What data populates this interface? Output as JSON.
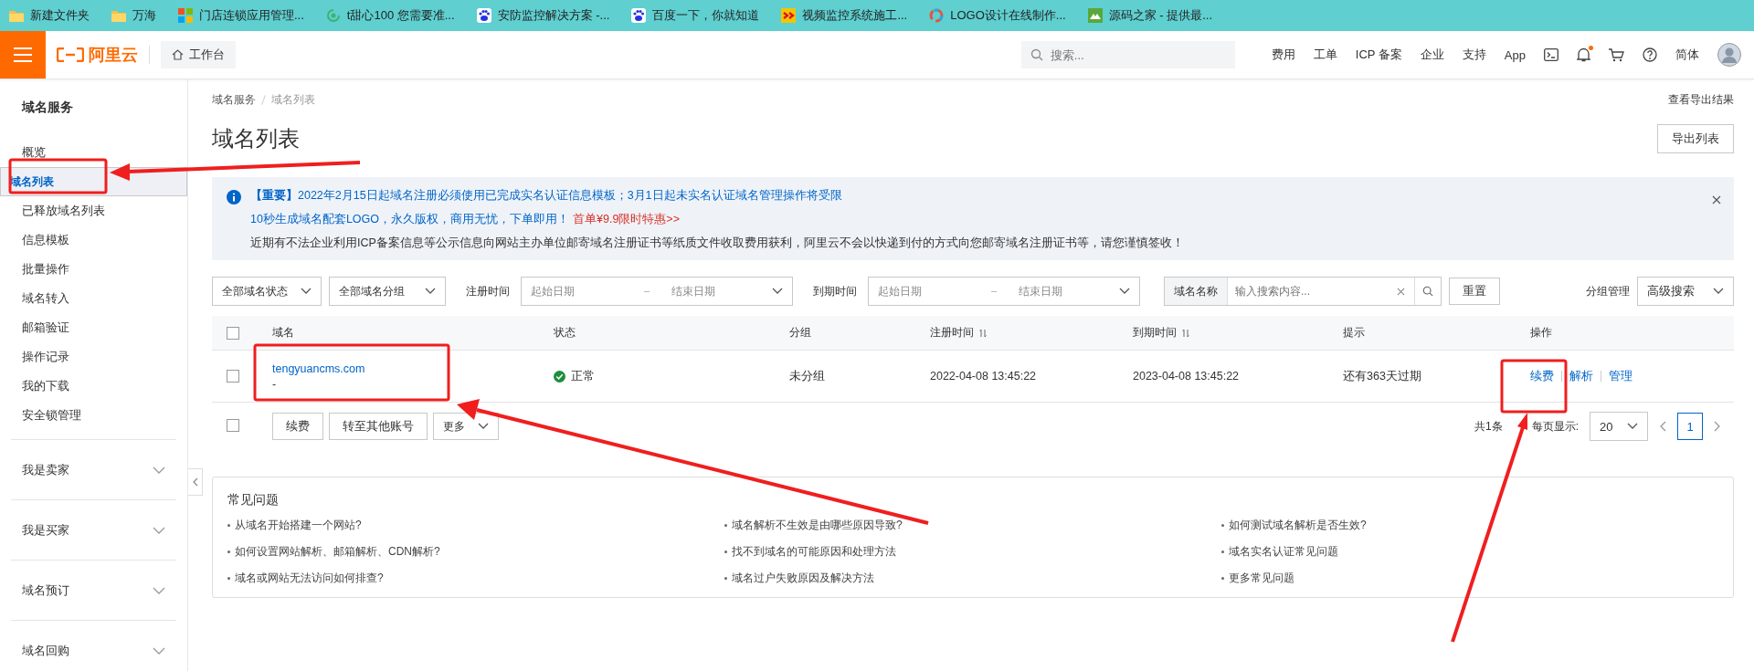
{
  "bookmarks": [
    {
      "label": "新建文件夹",
      "kind": "folder"
    },
    {
      "label": "万海",
      "kind": "folder"
    },
    {
      "label": "门店连锁应用管理...",
      "kind": "grid"
    },
    {
      "label": "t甜心100 您需要准...",
      "kind": "swirl"
    },
    {
      "label": "安防监控解决方案 -...",
      "kind": "paw"
    },
    {
      "label": "百度一下，你就知道",
      "kind": "paw"
    },
    {
      "label": "视频监控系统施工...",
      "kind": "sbadge"
    },
    {
      "label": "LOGO设计在线制作...",
      "kind": "ring"
    },
    {
      "label": "源码之家 - 提供最...",
      "kind": "mbadge"
    }
  ],
  "topbar": {
    "logo": "阿里云",
    "workbench": "工作台",
    "search_placeholder": "搜索...",
    "links": [
      "费用",
      "工单",
      "ICP 备案",
      "企业",
      "支持",
      "App"
    ],
    "notification_dot": true,
    "language": "简体"
  },
  "sidebar": {
    "title": "域名服务",
    "items": [
      {
        "label": "概览",
        "selected": false
      },
      {
        "label": "域名列表",
        "selected": true
      },
      {
        "label": "已释放域名列表",
        "selected": false
      },
      {
        "label": "信息模板",
        "selected": false
      },
      {
        "label": "批量操作",
        "selected": false
      },
      {
        "label": "域名转入",
        "selected": false
      },
      {
        "label": "邮箱验证",
        "selected": false
      },
      {
        "label": "操作记录",
        "selected": false
      },
      {
        "label": "我的下载",
        "selected": false
      },
      {
        "label": "安全锁管理",
        "selected": false
      }
    ],
    "sections": [
      {
        "label": "我是卖家",
        "expanded": false
      },
      {
        "label": "我是买家",
        "expanded": false
      },
      {
        "label": "域名预订",
        "expanded": false
      },
      {
        "label": "域名回购",
        "expanded": false
      }
    ]
  },
  "breadcrumb": [
    "域名服务",
    "域名列表"
  ],
  "page": {
    "title": "域名列表",
    "export_results": "查看导出结果",
    "export_button": "导出列表"
  },
  "notice": {
    "line1": "**【重要】**2022年2月15日起域名注册必须使用已完成实名认证信息模板；3月1日起未实名认证域名管理操作将受限",
    "line2": "10秒生成域名配套LOGO，永久版权，商用无忧，下单即用！",
    "line2_offer": "首单¥9.9限时特惠>>",
    "line3": "近期有不法企业利用ICP备案信息等公示信息向网站主办单位邮寄域名注册证书等纸质文件收取费用获利，阿里云不会以快递到付的方式向您邮寄域名注册证书等，请您谨慎签收！"
  },
  "filters": {
    "status": "全部域名状态",
    "group": "全部域名分组",
    "reg_label": "注册时间",
    "reg_start": "起始日期",
    "reg_end": "结束日期",
    "exp_label": "到期时间",
    "exp_start": "起始日期",
    "exp_end": "结束日期",
    "search_scope": "域名名称",
    "search_placeholder": "输入搜索内容...",
    "reset": "重置",
    "group_manage": "分组管理",
    "advanced": "高级搜索"
  },
  "table": {
    "header_checked": false,
    "columns": [
      {
        "label": "域名",
        "sortable": false
      },
      {
        "label": "状态",
        "sortable": false
      },
      {
        "label": "分组",
        "sortable": false
      },
      {
        "label": "注册时间",
        "sortable": true
      },
      {
        "label": "到期时间",
        "sortable": true
      },
      {
        "label": "提示",
        "sortable": false
      },
      {
        "label": "操作",
        "sortable": false
      }
    ],
    "rows": [
      {
        "checked": false,
        "domain": "tengyuancms.com",
        "remark": "-",
        "status": "正常",
        "group": "未分组",
        "registered": "2022-04-08 13:45:22",
        "expires": "2023-04-08 13:45:22",
        "hint": "还有363天过期",
        "actions": [
          "续费",
          "解析",
          "管理"
        ]
      }
    ]
  },
  "bulk": {
    "checked": false,
    "buttons": [
      "续费",
      "转至其他账号"
    ],
    "more": "更多"
  },
  "pagination": {
    "total": "共1条",
    "page_size_label": "每页显示:",
    "page_size": "20",
    "pages": [
      {
        "label": "1",
        "selected": true
      }
    ]
  },
  "faq": {
    "title": "常见问题",
    "items": [
      "从域名开始搭建一个网站?",
      "域名解析不生效是由哪些原因导致?",
      "如何测试域名解析是否生效?",
      "如何设置网站解析、邮箱解析、CDN解析?",
      "找不到域名的可能原因和处理方法",
      "域名实名认证常见问题",
      "域名或网站无法访问如何排查?",
      "域名过户失败原因及解决方法",
      "更多常见问题"
    ]
  }
}
